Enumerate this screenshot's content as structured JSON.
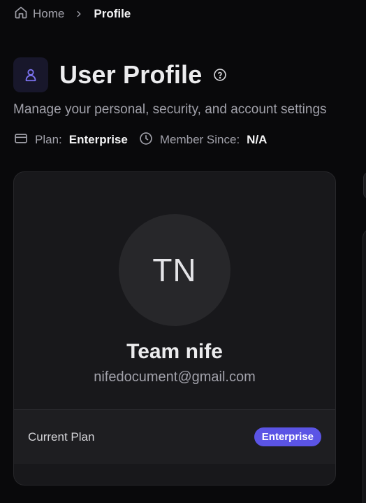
{
  "breadcrumb": {
    "home_label": "Home",
    "current_label": "Profile"
  },
  "header": {
    "title": "User Profile",
    "subtitle": "Manage your personal, security, and account settings",
    "icon": "user-icon",
    "help_icon": "help-circle-icon"
  },
  "meta": {
    "plan_key": "Plan:",
    "plan_value": "Enterprise",
    "member_key": "Member Since:",
    "member_value": "N/A"
  },
  "profile": {
    "initials": "TN",
    "name": "Team nife",
    "email": "nifedocument@gmail.com",
    "plan_label": "Current Plan",
    "plan_badge": "Enterprise"
  },
  "colors": {
    "accent": "#5b54e5",
    "background": "#09090b",
    "card": "#18181b"
  }
}
